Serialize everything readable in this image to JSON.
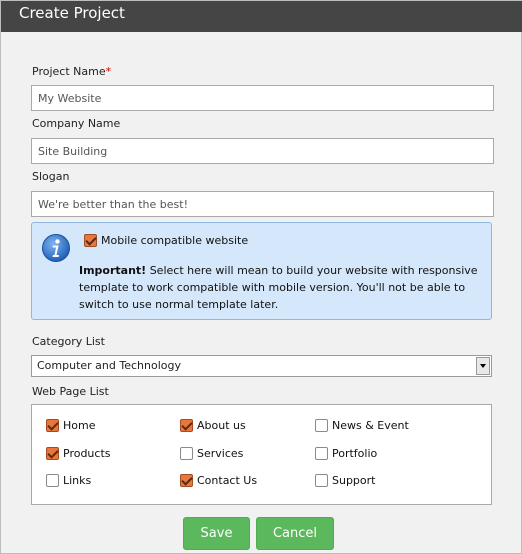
{
  "dialog": {
    "title": "Create Project"
  },
  "form": {
    "project_name": {
      "label": "Project Name",
      "required_mark": "*",
      "value": "My Website"
    },
    "company_name": {
      "label": "Company Name",
      "value": "Site Building"
    },
    "slogan": {
      "label": "Slogan",
      "value": "We're better than the best!"
    }
  },
  "info": {
    "icon": "info-icon",
    "checkbox_label": "Mobile compatible website",
    "checkbox_checked": true,
    "important_label": "Important!",
    "message": "Select here will mean to build your website with responsive template to work compatible with mobile version. You'll not be able to switch to use normal template later."
  },
  "category": {
    "label": "Category List",
    "selected": "Computer and Technology"
  },
  "pages": {
    "label": "Web Page List",
    "items": [
      {
        "label": "Home",
        "checked": true
      },
      {
        "label": "About us",
        "checked": true
      },
      {
        "label": "News & Event",
        "checked": false
      },
      {
        "label": "Products",
        "checked": true
      },
      {
        "label": "Services",
        "checked": false
      },
      {
        "label": "Portfolio",
        "checked": false
      },
      {
        "label": "Links",
        "checked": false
      },
      {
        "label": "Contact Us",
        "checked": true
      },
      {
        "label": "Support",
        "checked": false
      }
    ]
  },
  "buttons": {
    "save": "Save",
    "cancel": "Cancel"
  },
  "colors": {
    "titlebar": "#454545",
    "info_bg": "#d5e7fb",
    "checkbox_checked": "#e9773d",
    "button": "#5cb85c"
  }
}
